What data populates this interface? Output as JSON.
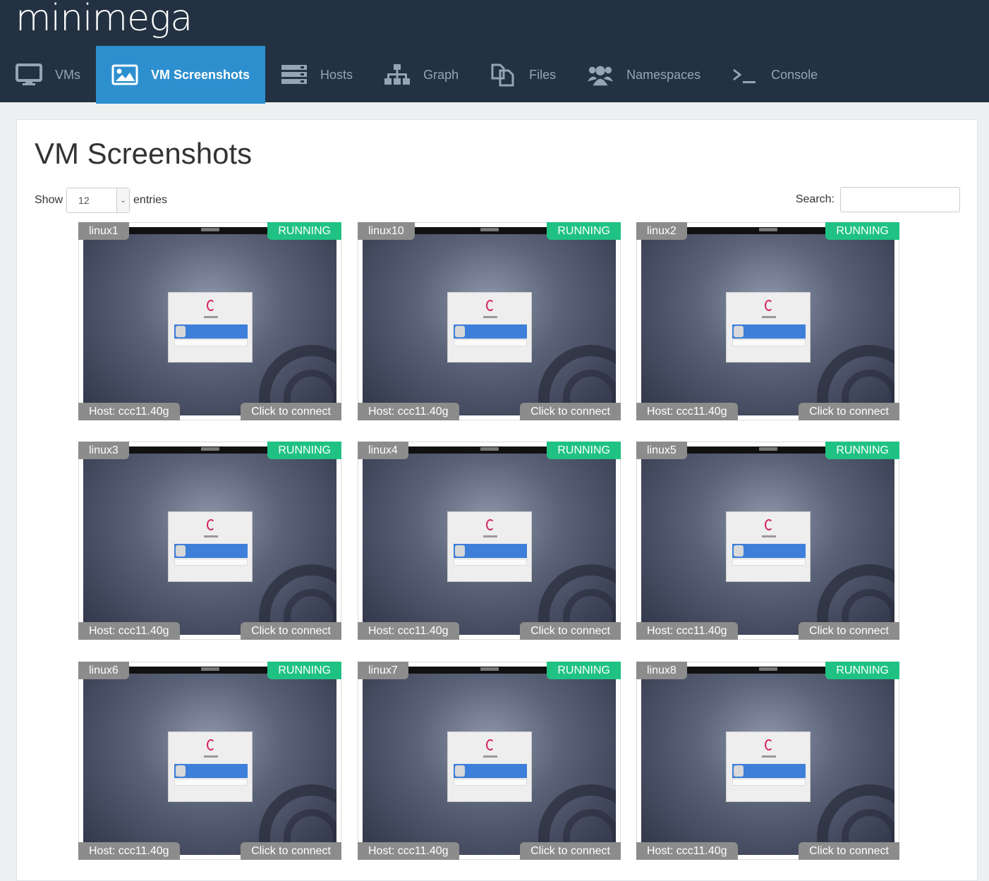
{
  "app": {
    "logo_text": "minimega"
  },
  "nav": [
    {
      "label": "VMs",
      "icon": "monitor-icon",
      "active": false
    },
    {
      "label": "VM Screenshots",
      "icon": "image-icon",
      "active": true
    },
    {
      "label": "Hosts",
      "icon": "server-icon",
      "active": false
    },
    {
      "label": "Graph",
      "icon": "sitemap-icon",
      "active": false
    },
    {
      "label": "Files",
      "icon": "files-icon",
      "active": false
    },
    {
      "label": "Namespaces",
      "icon": "users-icon",
      "active": false
    },
    {
      "label": "Console",
      "icon": "terminal-icon",
      "active": false
    }
  ],
  "page": {
    "title": "VM Screenshots"
  },
  "table_controls": {
    "show_label": "Show",
    "entries_value": "12",
    "entries_label": "entries",
    "search_label": "Search:",
    "search_value": ""
  },
  "vms": [
    {
      "name": "linux1",
      "status": "RUNNING",
      "host": "Host: ccc11.40g",
      "action": "Click to connect"
    },
    {
      "name": "linux10",
      "status": "RUNNING",
      "host": "Host: ccc11.40g",
      "action": "Click to connect"
    },
    {
      "name": "linux2",
      "status": "RUNNING",
      "host": "Host: ccc11.40g",
      "action": "Click to connect"
    },
    {
      "name": "linux3",
      "status": "RUNNING",
      "host": "Host: ccc11.40g",
      "action": "Click to connect"
    },
    {
      "name": "linux4",
      "status": "RUNNING",
      "host": "Host: ccc11.40g",
      "action": "Click to connect"
    },
    {
      "name": "linux5",
      "status": "RUNNING",
      "host": "Host: ccc11.40g",
      "action": "Click to connect"
    },
    {
      "name": "linux6",
      "status": "RUNNING",
      "host": "Host: ccc11.40g",
      "action": "Click to connect"
    },
    {
      "name": "linux7",
      "status": "RUNNING",
      "host": "Host: ccc11.40g",
      "action": "Click to connect"
    },
    {
      "name": "linux8",
      "status": "RUNNING",
      "host": "Host: ccc11.40g",
      "action": "Click to connect"
    }
  ],
  "colors": {
    "header_bg": "#233142",
    "active_tab": "#2e8fcf",
    "status_running": "#1fc282",
    "label_gray": "#8c8c8c"
  }
}
